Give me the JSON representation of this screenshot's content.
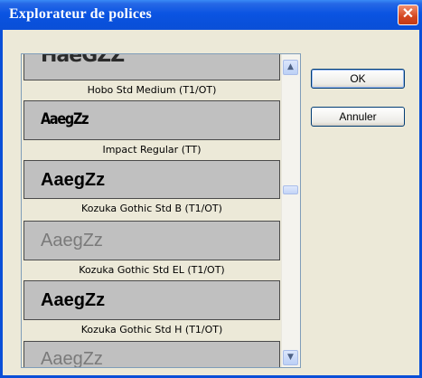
{
  "dialog": {
    "title": "Explorateur de polices",
    "close_glyph": "✕"
  },
  "buttons": {
    "ok_label": "OK",
    "cancel_label": "Annuler"
  },
  "font_list": {
    "preview_sample": "AaegZz",
    "items": [
      {
        "preview": "HaeGZZ",
        "caption": "Hobo Std Medium (T1/OT)"
      },
      {
        "preview": "AaegZz",
        "caption": "Impact Regular (TT)"
      },
      {
        "preview": "AaegZz",
        "caption": "Kozuka Gothic Std B (T1/OT)"
      },
      {
        "preview": "AaegZz",
        "caption": "Kozuka Gothic Std EL (T1/OT)"
      },
      {
        "preview": "AaegZz",
        "caption": "Kozuka Gothic Std H (T1/OT)"
      },
      {
        "preview": "AaegZz",
        "caption": ""
      }
    ]
  },
  "scrollbar": {
    "up_icon": "▲",
    "down_icon": "▼"
  },
  "colors": {
    "title_bar": "#0a4fd8",
    "dialog_bg": "#ece9d8",
    "preview_bg": "#c0c0c0",
    "close_button": "#d4461f"
  }
}
